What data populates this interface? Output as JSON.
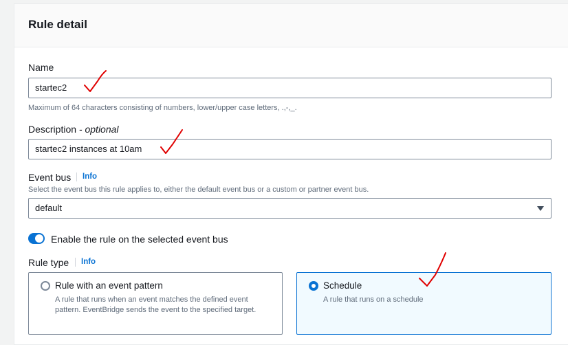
{
  "panel": {
    "title": "Rule detail"
  },
  "name_field": {
    "label": "Name",
    "value": "startec2",
    "hint": "Maximum of 64 characters consisting of numbers, lower/upper case letters, .,-,_."
  },
  "description_field": {
    "label": "Description",
    "optional": "optional",
    "label_sep": " - ",
    "value": "startec2 instances at 10am"
  },
  "event_bus": {
    "label": "Event bus",
    "info": "Info",
    "hint": "Select the event bus this rule applies to, either the default event bus or a custom or partner event bus.",
    "value": "default"
  },
  "enable_toggle": {
    "label": "Enable the rule on the selected event bus",
    "enabled": true
  },
  "rule_type": {
    "label": "Rule type",
    "info": "Info",
    "options": [
      {
        "title": "Rule with an event pattern",
        "description": "A rule that runs when an event matches the defined event pattern. EventBridge sends the event to the specified target.",
        "selected": false
      },
      {
        "title": "Schedule",
        "description": "A rule that runs on a schedule",
        "selected": true
      }
    ]
  },
  "colors": {
    "accent": "#0972d3",
    "annotation": "#e00000"
  },
  "icons": {
    "select_arrow": "caret-down-icon",
    "annotation": "red-checkmark-annotation"
  }
}
